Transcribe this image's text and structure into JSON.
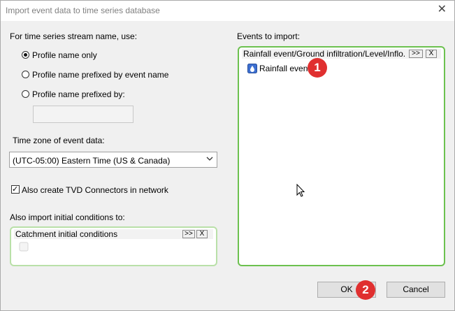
{
  "window": {
    "title": "Import event data to time series database",
    "close_symbol": "✕"
  },
  "stream_name": {
    "label": "For time series stream name, use:",
    "options": [
      {
        "label": "Profile name only",
        "checked": true
      },
      {
        "label": "Profile name prefixed by event name",
        "checked": false
      },
      {
        "label": "Profile name prefixed by:",
        "checked": false
      }
    ],
    "prefix_value": ""
  },
  "timezone": {
    "label": "Time zone of event data:",
    "selected": "(UTC-05:00) Eastern Time (US & Canada)"
  },
  "tvd": {
    "label": "Also create TVD Connectors in network",
    "checked": true,
    "check_symbol": "✓"
  },
  "initial_conditions": {
    "label": "Also import initial conditions to:",
    "panel_title": "Catchment initial conditions",
    "expand_label": ">>",
    "close_label": "X"
  },
  "events": {
    "label": "Events to import:",
    "panel_title": "Rainfall event/Ground infiltration/Level/Inflo.",
    "expand_label": ">>",
    "close_label": "X",
    "items": [
      {
        "label": "Rainfall event",
        "icon": "rainfall-event-icon"
      }
    ]
  },
  "buttons": {
    "ok": "OK",
    "cancel": "Cancel"
  },
  "badges": [
    "1",
    "2"
  ]
}
